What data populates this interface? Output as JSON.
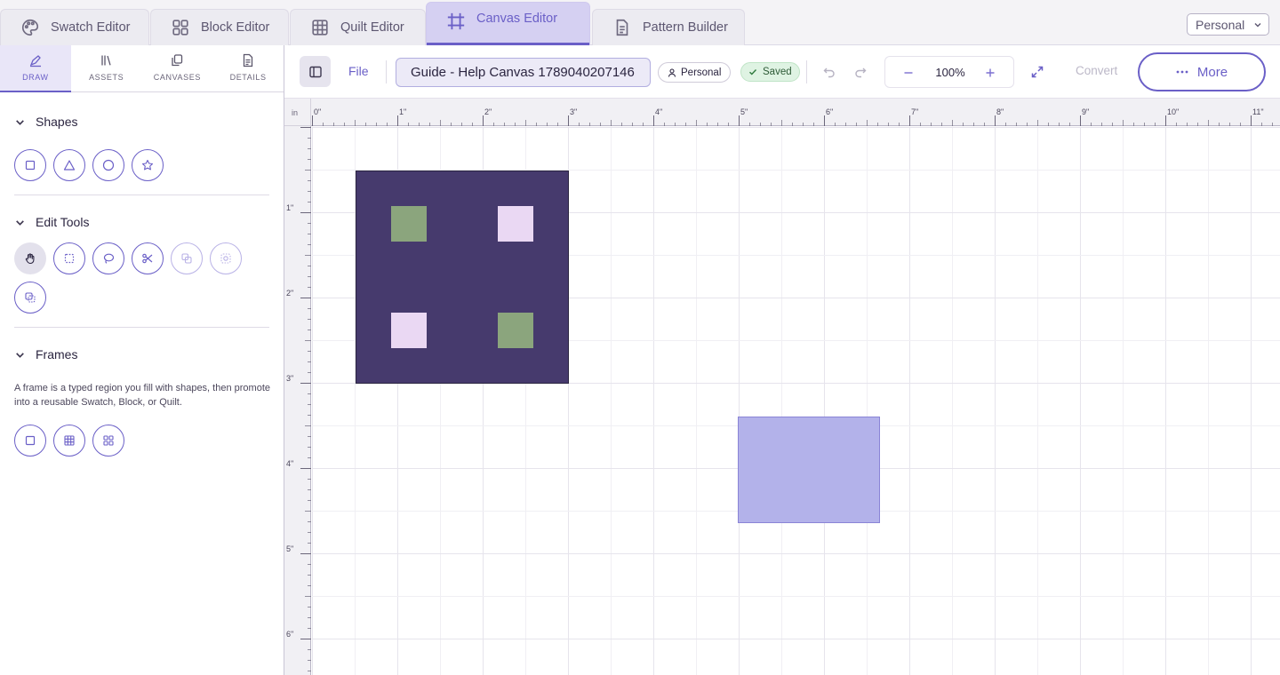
{
  "editor_tabs": [
    {
      "label": "Swatch Editor",
      "icon": "palette-icon"
    },
    {
      "label": "Block Editor",
      "icon": "grid-2x2-icon"
    },
    {
      "label": "Quilt Editor",
      "icon": "grid-3x3-icon"
    },
    {
      "label": "Canvas Editor",
      "icon": "frame-icon",
      "active": true
    },
    {
      "label": "Pattern Builder",
      "icon": "document-icon"
    }
  ],
  "workspace_select": {
    "value": "Personal"
  },
  "sidebar": {
    "tabs": [
      {
        "label": "DRAW",
        "icon": "pen-icon",
        "active": true
      },
      {
        "label": "ASSETS",
        "icon": "library-icon"
      },
      {
        "label": "CANVASES",
        "icon": "copy-icon"
      },
      {
        "label": "DETAILS",
        "icon": "details-icon"
      }
    ],
    "sections": {
      "shapes": {
        "title": "Shapes",
        "tools": [
          "square-tool",
          "triangle-tool",
          "circle-tool",
          "star-tool"
        ]
      },
      "edit_tools": {
        "title": "Edit Tools",
        "tools": [
          "pan-tool",
          "marquee-select-tool",
          "lasso-tool",
          "cut-tool",
          "merge-tool-disabled",
          "focus-tool-disabled",
          "duplicate-tool"
        ]
      },
      "frames": {
        "title": "Frames",
        "description": "A frame is a typed region you fill with shapes, then promote into a reusable Swatch, Block, or Quilt.",
        "tools": [
          "swatch-frame-tool",
          "quilt-frame-tool",
          "block-frame-tool"
        ]
      }
    }
  },
  "toolbar": {
    "file_label": "File",
    "canvas_title": "Guide - Help Canvas 1789040207146",
    "owner_label": "Personal",
    "saved_label": "Saved",
    "zoom": "100%",
    "convert_label": "Convert",
    "more_label": "More"
  },
  "canvas": {
    "ruler_unit": "in",
    "ruler_top_labels": [
      "0\"",
      "1\"",
      "2\"",
      "3\"",
      "4\"",
      "5\"",
      "6\"",
      "7\"",
      "8\"",
      "9\"",
      "10\"",
      "11\""
    ],
    "ruler_left_labels": [
      "1\"",
      "2\"",
      "3\"",
      "4\"",
      "5\"",
      "6\""
    ],
    "colors": {
      "block_background": "#463a6d",
      "sage_square": "#8ba57d",
      "lilac_square": "#ead8f3",
      "selected_rect": "#b3b2ea",
      "selected_rect_border": "#8a84d6",
      "accent": "#6a5fc7"
    }
  }
}
